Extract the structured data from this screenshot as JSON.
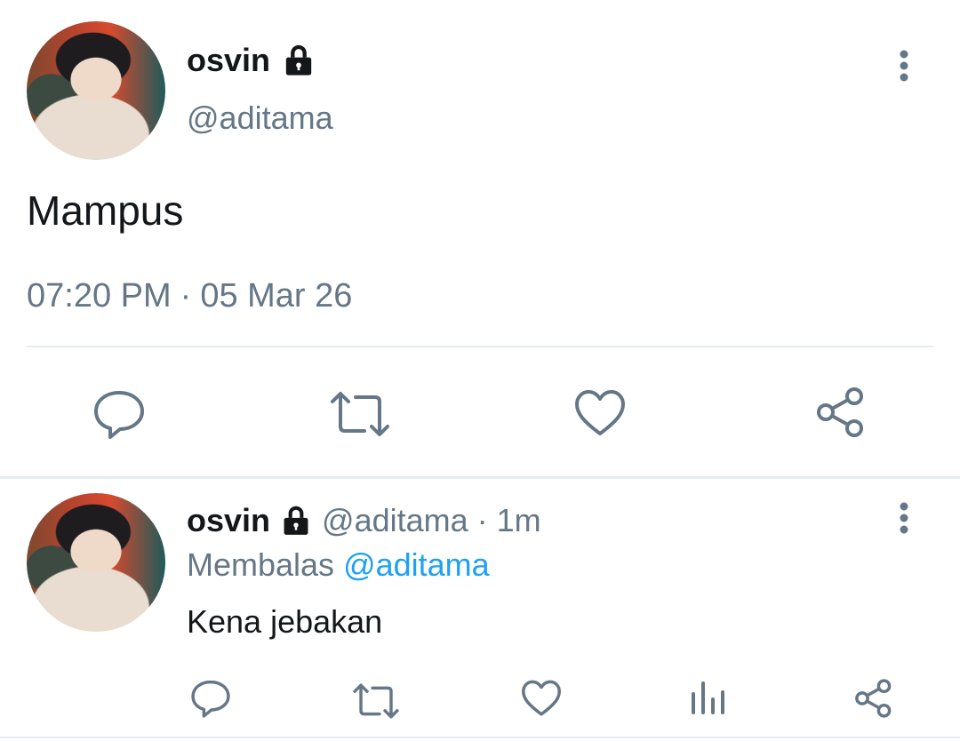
{
  "main_tweet": {
    "author_name": "osvin",
    "author_handle": "@aditama",
    "text": "Mampus",
    "time": "07:20 PM",
    "separator": "·",
    "date": "05 Mar 26",
    "locked": true
  },
  "reply_tweet": {
    "author_name": "osvin",
    "author_handle": "@aditama",
    "separator": "·",
    "age": "1m",
    "replying_prefix": "Membalas",
    "replying_to": "@aditama",
    "text": "Kena jebakan",
    "locked": true
  },
  "icons": {
    "more": "more-vertical-icon",
    "lock": "lock-icon",
    "reply": "reply-icon",
    "retweet": "retweet-icon",
    "like": "heart-icon",
    "share": "share-icon",
    "analytics": "analytics-icon"
  },
  "colors": {
    "text_primary": "#14171a",
    "text_secondary": "#657786",
    "link": "#1da1f2",
    "divider": "#e6ecf0"
  }
}
